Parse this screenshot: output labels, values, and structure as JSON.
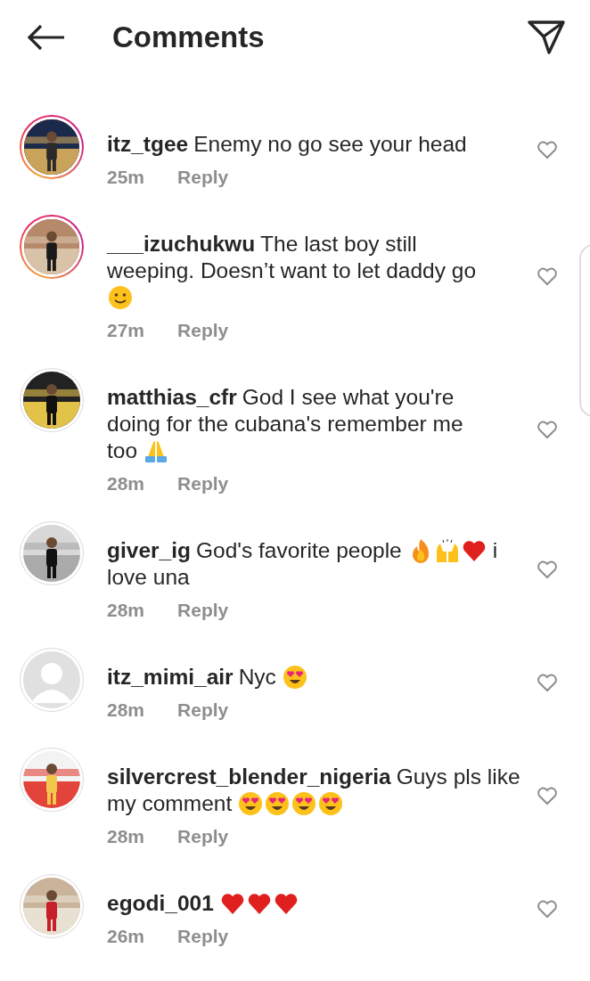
{
  "header": {
    "title": "Comments"
  },
  "comments": [
    {
      "username": "itz_tgee",
      "avatar": {
        "kind": "picture",
        "story": true
      },
      "lines": [
        [
          {
            "kind": "text",
            "text": "Enemy no go see your head"
          }
        ]
      ],
      "time": "25m",
      "reply": "Reply",
      "liked": false
    },
    {
      "username": "___izuchukwu",
      "avatar": {
        "kind": "picture",
        "story": true
      },
      "lines": [
        [
          {
            "kind": "text",
            "text": "The last boy still"
          }
        ],
        [
          {
            "kind": "text",
            "text": "weeping. Doesn’t want to let daddy go"
          }
        ],
        [
          {
            "kind": "smile"
          }
        ]
      ],
      "time": "27m",
      "reply": "Reply",
      "liked": false
    },
    {
      "username": "matthias_cfr",
      "avatar": {
        "kind": "picture",
        "story": false
      },
      "lines": [
        [
          {
            "kind": "text",
            "text": "God I see what you're"
          }
        ],
        [
          {
            "kind": "text",
            "text": "doing for the cubana's remember me"
          }
        ],
        [
          {
            "kind": "text",
            "text": "too"
          },
          {
            "kind": "pray"
          }
        ]
      ],
      "time": "28m",
      "reply": "Reply",
      "liked": false
    },
    {
      "username": "giver_ig",
      "avatar": {
        "kind": "picture",
        "story": false
      },
      "lines": [
        [
          {
            "kind": "text",
            "text": "God's favorite people"
          },
          {
            "kind": "fire"
          },
          {
            "kind": "raised-hands"
          },
          {
            "kind": "heart"
          },
          {
            "kind": "text",
            "text": "i"
          }
        ],
        [
          {
            "kind": "text",
            "text": "love una"
          }
        ]
      ],
      "time": "28m",
      "reply": "Reply",
      "liked": false
    },
    {
      "username": "itz_mimi_air",
      "avatar": {
        "kind": "default",
        "story": false
      },
      "lines": [
        [
          {
            "kind": "text",
            "text": "Nyc"
          },
          {
            "kind": "heart-eyes"
          }
        ]
      ],
      "time": "28m",
      "reply": "Reply",
      "liked": false
    },
    {
      "username": "silvercrest_blender_nigeria",
      "avatar": {
        "kind": "picture",
        "story": false
      },
      "lines": [
        [
          {
            "kind": "text",
            "text": "Guys pls like"
          }
        ],
        [
          {
            "kind": "text",
            "text": "my comment"
          },
          {
            "kind": "heart-eyes"
          },
          {
            "kind": "heart-eyes"
          },
          {
            "kind": "heart-eyes"
          },
          {
            "kind": "heart-eyes"
          }
        ]
      ],
      "time": "28m",
      "reply": "Reply",
      "liked": false
    },
    {
      "username": "egodi_001",
      "avatar": {
        "kind": "picture",
        "story": false
      },
      "lines": [
        [
          {
            "kind": "heart"
          },
          {
            "kind": "heart"
          },
          {
            "kind": "heart"
          }
        ]
      ],
      "time": "26m",
      "reply": "Reply",
      "liked": false
    }
  ]
}
